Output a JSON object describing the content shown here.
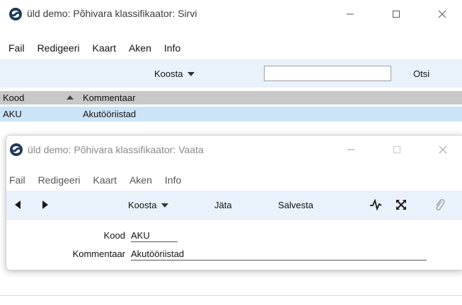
{
  "browse_window": {
    "title": "üld demo: Põhivara klassifikaator: Sirvi",
    "menu": [
      "Fail",
      "Redigeeri",
      "Kaart",
      "Aken",
      "Info"
    ],
    "toolbar": {
      "create_label": "Koosta",
      "search_value": "",
      "search_button": "Otsi"
    },
    "table": {
      "columns": [
        "Kood",
        "Kommentaar"
      ],
      "rows": [
        {
          "code": "AKU",
          "comment": "Akutööriistad"
        }
      ]
    }
  },
  "record_window": {
    "title": "üld demo: Põhivara klassifikaator: Vaata",
    "menu": [
      "Fail",
      "Redigeeri",
      "Kaart",
      "Aken",
      "Info"
    ],
    "toolbar": {
      "create_label": "Koosta",
      "skip_label": "Jäta",
      "save_label": "Salvesta"
    },
    "fields": {
      "code_label": "Kood",
      "code_value": "AKU",
      "comment_label": "Kommentaar",
      "comment_value": "Akutööriistad"
    }
  },
  "icons": {
    "app": "app-logo-icon",
    "minimize": "minimize-icon",
    "maximize": "maximize-icon",
    "close": "close-icon",
    "prev": "previous-record-icon",
    "next": "next-record-icon",
    "pulse": "activity-icon",
    "expand": "expand-icon",
    "attach": "paperclip-icon"
  },
  "colors": {
    "toolbar_bg": "#e9f2fb",
    "selected_row": "#cce4f7",
    "header_bg": "#c8c8c8"
  }
}
